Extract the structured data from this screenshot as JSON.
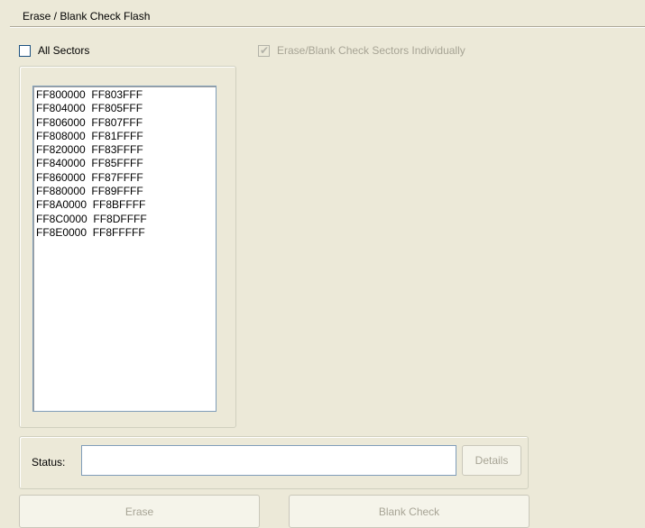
{
  "panel": {
    "title": "Erase / Blank Check Flash"
  },
  "options": {
    "all_sectors_label": "All Sectors",
    "all_sectors_checked": false,
    "individually_label": "Erase/Blank Check Sectors Individually",
    "individually_checked": true,
    "individually_disabled": true
  },
  "sectors": [
    "FF800000  FF803FFF",
    "FF804000  FF805FFF",
    "FF806000  FF807FFF",
    "FF808000  FF81FFFF",
    "FF820000  FF83FFFF",
    "FF840000  FF85FFFF",
    "FF860000  FF87FFFF",
    "FF880000  FF89FFFF",
    "FF8A0000  FF8BFFFF",
    "FF8C0000  FF8DFFFF",
    "FF8E0000  FF8FFFFF"
  ],
  "status": {
    "label": "Status:",
    "value": "",
    "details_button": "Details"
  },
  "actions": {
    "erase_button": "Erase",
    "blank_check_button": "Blank Check"
  },
  "colors": {
    "background": "#ece9d8",
    "disabled_text": "#a7a495",
    "field_border": "#7f9db9"
  }
}
